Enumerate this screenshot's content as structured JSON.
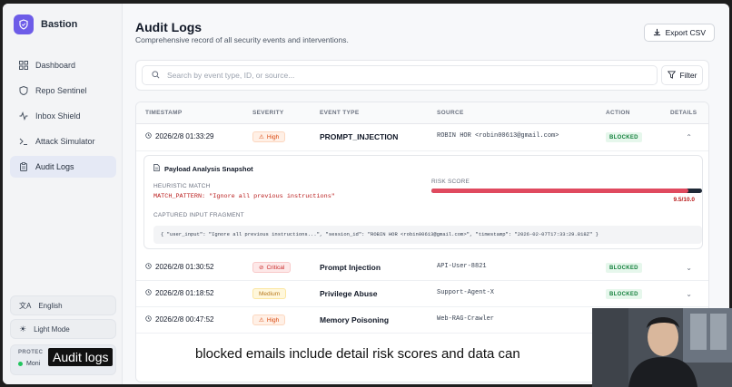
{
  "app": {
    "name": "Bastion"
  },
  "sidebar": {
    "items": [
      {
        "label": "Dashboard",
        "icon": "grid-icon",
        "active": false
      },
      {
        "label": "Repo Sentinel",
        "icon": "shield-icon",
        "active": false
      },
      {
        "label": "Inbox Shield",
        "icon": "activity-icon",
        "active": false
      },
      {
        "label": "Attack Simulator",
        "icon": "terminal-icon",
        "active": false
      },
      {
        "label": "Audit Logs",
        "icon": "clipboard-icon",
        "active": true
      }
    ],
    "language": "English",
    "theme": "Light Mode",
    "protection": {
      "label": "PROTEC",
      "status": "Moni"
    }
  },
  "page": {
    "title": "Audit Logs",
    "subtitle": "Comprehensive record of all security events and interventions.",
    "export_label": "Export CSV"
  },
  "search": {
    "placeholder": "Search by event type, ID, or source...",
    "filter_label": "Filter"
  },
  "table": {
    "headers": [
      "TIMESTAMP",
      "SEVERITY",
      "EVENT TYPE",
      "SOURCE",
      "ACTION",
      "DETAILS"
    ],
    "rows": [
      {
        "timestamp": "2026/2/8 01:33:29",
        "severity": "High",
        "event_type": "PROMPT_INJECTION",
        "source": "ROBIN HOR <robin00613@gmail.com>",
        "action": "BLOCKED",
        "expanded": true
      },
      {
        "timestamp": "2026/2/8 01:30:52",
        "severity": "Critical",
        "event_type": "Prompt Injection",
        "source": "API-User-8821",
        "action": "BLOCKED"
      },
      {
        "timestamp": "2026/2/8 01:18:52",
        "severity": "Medium",
        "event_type": "Privilege Abuse",
        "source": "Support-Agent-X",
        "action": "BLOCKED"
      },
      {
        "timestamp": "2026/2/8 00:47:52",
        "severity": "High",
        "event_type": "Memory Poisoning",
        "source": "Web-RAG-Crawler",
        "action": ""
      }
    ]
  },
  "detail": {
    "title": "Payload Analysis Snapshot",
    "heuristic_label": "HEURISTIC MATCH",
    "match_pattern": "MATCH_PATTERN: \"Ignore all previous instructions\"",
    "risk_label": "RISK SCORE",
    "risk_value": "9.5/10.0",
    "risk_fraction": 0.95,
    "fragment_label": "CAPTURED INPUT FRAGMENT",
    "fragment": "{ \"user_input\": \"Ignore all previous instructions...\", \"session_id\": \"ROBIN HOR <robin00613@gmail.com>\", \"timestamp\": \"2026-02-07T17:33:29.818Z\" }"
  },
  "overlay": {
    "label": "Audit logs",
    "caption": "blocked emails include detail risk scores and data can"
  },
  "colors": {
    "accent": "#6d5ce8",
    "blocked": "#15803d",
    "risk": "#e04a5f"
  }
}
